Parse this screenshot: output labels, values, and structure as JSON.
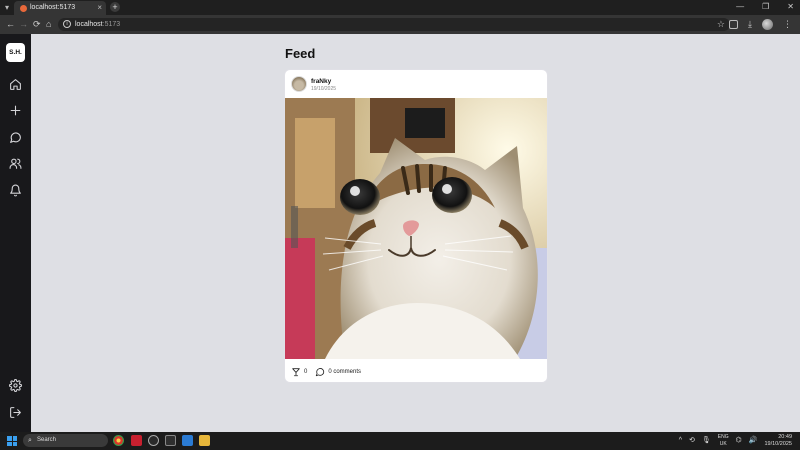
{
  "browser": {
    "tab_title": "localhost:5173",
    "tab_close": "×",
    "new_tab": "+",
    "url_host": "localhost",
    "url_port": ":5173",
    "nav_back": "←",
    "nav_forward": "→",
    "nav_reload": "⟳",
    "nav_home": "⌂",
    "star": "☆",
    "window_controls": [
      "—",
      "❐",
      "✕"
    ]
  },
  "sidebar": {
    "logo": "S.H.",
    "items": [
      {
        "name": "home-icon"
      },
      {
        "name": "plus-icon"
      },
      {
        "name": "chat-icon"
      },
      {
        "name": "users-icon"
      },
      {
        "name": "bell-icon"
      },
      {
        "name": "gear-icon"
      },
      {
        "name": "logout-icon"
      }
    ]
  },
  "feed": {
    "title": "Feed",
    "post": {
      "username": "fraNky",
      "date": "19/10/2025",
      "image_alt": "smiling cat",
      "likes": "0",
      "comments_label": "0 comments"
    }
  },
  "taskbar": {
    "search_placeholder": "Search",
    "tray_symbol": "^",
    "lang_top": "ENG",
    "lang_bottom": "UK",
    "time": "20:49",
    "date": "19/10/2025"
  },
  "colors": {
    "page_bg": "#dedfe4",
    "sidebar_bg": "#18181b",
    "card_bg": "#ffffff",
    "taskbar_bg": "#1c1c1c"
  }
}
